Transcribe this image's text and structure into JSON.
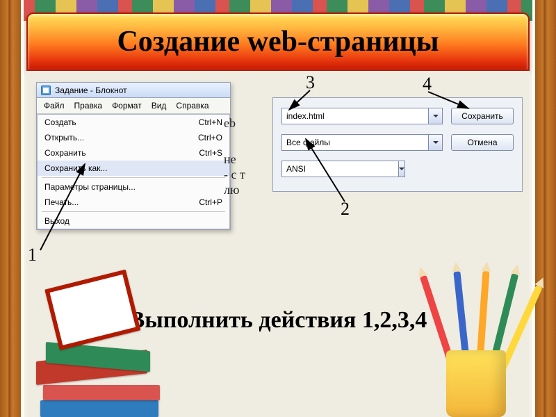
{
  "slide": {
    "title": "Создание web-страницы",
    "instruction": "Выполнить действия 1,2,3,4"
  },
  "notepad": {
    "window_title": "Задание - Блокнот",
    "menubar": [
      "Файл",
      "Правка",
      "Формат",
      "Вид",
      "Справка"
    ],
    "file_menu": [
      {
        "label": "Создать",
        "shortcut": "Ctrl+N"
      },
      {
        "label": "Открыть...",
        "shortcut": "Ctrl+O"
      },
      {
        "label": "Сохранить",
        "shortcut": "Ctrl+S"
      },
      {
        "label": "Сохранить как...",
        "shortcut": "",
        "highlighted": true
      },
      {
        "separator": true
      },
      {
        "label": "Параметры страницы...",
        "shortcut": ""
      },
      {
        "label": "Печать...",
        "shortcut": "Ctrl+P"
      },
      {
        "separator": true
      },
      {
        "label": "Выход",
        "shortcut": ""
      }
    ],
    "body_fragment_lines": [
      "eb",
      "не",
      "- с т",
      "лю"
    ]
  },
  "save_dialog": {
    "filename": "index.html",
    "filetype": "Все файлы",
    "encoding": "ANSI",
    "save_btn": "Сохранить",
    "cancel_btn": "Отмена"
  },
  "callouts": {
    "n1": "1",
    "n2": "2",
    "n3": "3",
    "n4": "4"
  }
}
